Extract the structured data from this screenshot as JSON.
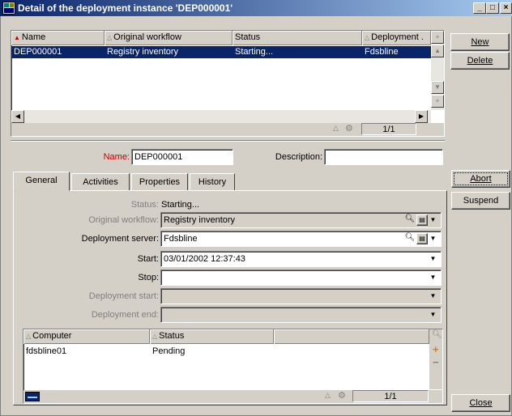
{
  "window": {
    "title": "Detail of the deployment instance 'DEP000001'",
    "minimize": "_",
    "restore": "□",
    "close": "×"
  },
  "list": {
    "columns": [
      "Name",
      "Original workflow",
      "Status",
      "Deployment ."
    ],
    "rows": [
      [
        "DEP000001",
        "Registry inventory",
        "Starting...",
        "Fdsbline"
      ]
    ],
    "counter": "1/1"
  },
  "buttons": {
    "new": "New",
    "delete": "Delete",
    "abort": "Abort",
    "suspend": "Suspend",
    "close": "Close"
  },
  "form": {
    "name_label": "Name:",
    "name_value": "DEP000001",
    "description_label": "Description:",
    "description_value": ""
  },
  "tabs": [
    "General",
    "Activities",
    "Properties",
    "History"
  ],
  "general": {
    "status_label": "Status:",
    "status_value": "Starting...",
    "workflow_label": "Original workflow:",
    "workflow_value": "Registry inventory",
    "server_label": "Deployment server:",
    "server_value": "Fdsbline",
    "start_label": "Start:",
    "start_value": "03/01/2002 12:37:43",
    "stop_label": "Stop:",
    "stop_value": "",
    "dstart_label": "Deployment start:",
    "dstart_value": "",
    "dend_label": "Deployment end:",
    "dend_value": ""
  },
  "subgrid": {
    "columns": [
      "Computer",
      "Status"
    ],
    "rows": [
      [
        "fdsbline01",
        "Pending"
      ]
    ],
    "counter": "1/1"
  },
  "icons": {
    "window": "app-window-icon",
    "zoom": "magnifier-icon",
    "details": "details-icon",
    "add": "plus-icon",
    "remove": "minus-icon",
    "filter": "filter-icon",
    "summary": "table-icon"
  },
  "colors": {
    "title_start": "#0a246a",
    "title_end": "#a6caf0",
    "selection": "#0a246a",
    "mandatory_label": "#c00000",
    "face": "#d4d0c8"
  }
}
